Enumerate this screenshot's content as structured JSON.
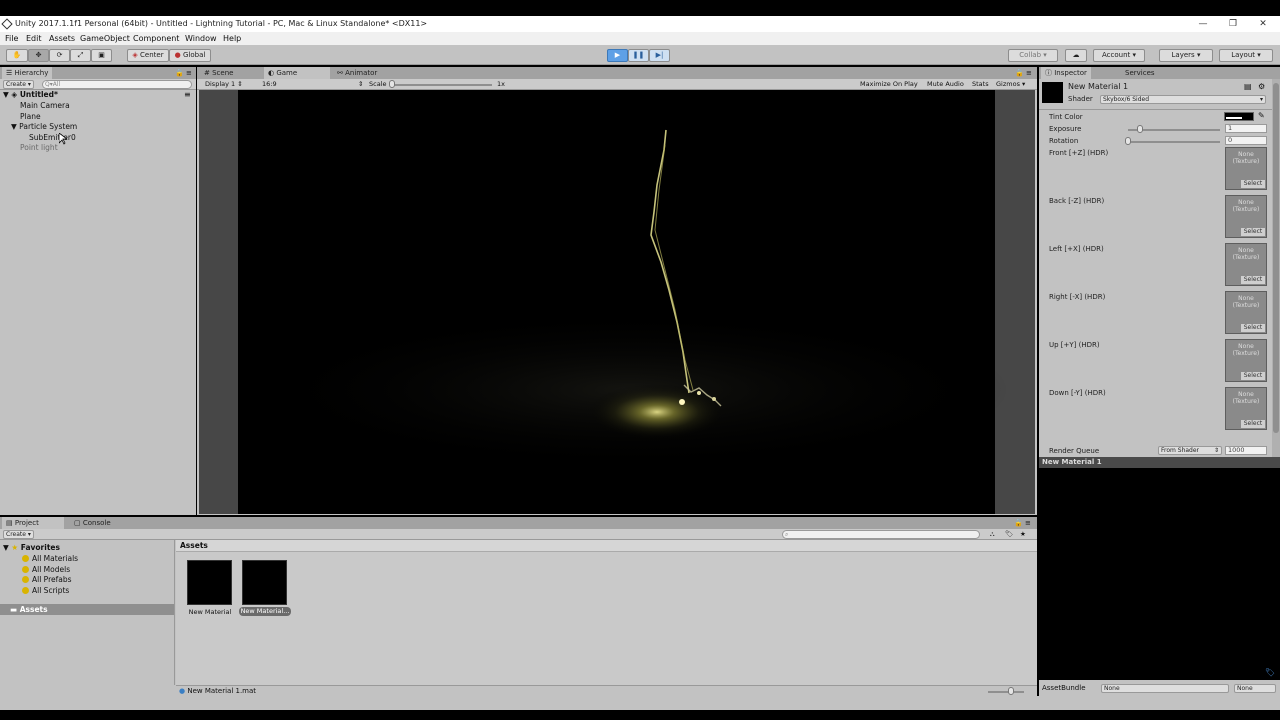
{
  "window": {
    "title": "Unity 2017.1.1f1 Personal (64bit) - Untitled - Lightning Tutorial - PC, Mac & Linux Standalone* <DX11>",
    "minimize_glyph": "—",
    "maximize_glyph": "❐",
    "close_glyph": "✕"
  },
  "menu": {
    "items": [
      "File",
      "Edit",
      "Assets",
      "GameObject",
      "Component",
      "Window",
      "Help"
    ]
  },
  "toolbar": {
    "pivot_label": "Center",
    "space_label": "Global",
    "collab_label": "Collab ▾",
    "account_label": "Account",
    "layers_label": "Layers",
    "layout_label": "Layout"
  },
  "hierarchy": {
    "tab": "Hierarchy",
    "create_label": "Create",
    "search_placeholder": "Q▾All",
    "scene": "Untitled*",
    "items": [
      {
        "label": "Main Camera",
        "indent": 1
      },
      {
        "label": "Plane",
        "indent": 1
      },
      {
        "label": "Particle System",
        "indent": 1,
        "expanded": true
      },
      {
        "label": "SubEmitter0",
        "indent": 2
      },
      {
        "label": "Point light",
        "indent": 1,
        "dim": true
      }
    ]
  },
  "center_tabs": {
    "scene": "Scene",
    "game": "Game",
    "animator": "Animator"
  },
  "game_view": {
    "display": "Display 1",
    "aspect": "16:9",
    "scale_label": "Scale",
    "scale_value": "1x",
    "scale_fraction": 0.0,
    "maximize": "Maximize On Play",
    "mute": "Mute Audio",
    "stats": "Stats",
    "gizmos": "Gizmos"
  },
  "inspector": {
    "tab": "Inspector",
    "services_tab": "Services",
    "material_name": "New Material 1",
    "shader_label": "Shader",
    "shader_value": "Skybox/6 Sided",
    "tint_label": "Tint Color",
    "exposure_label": "Exposure",
    "exposure_value": "1",
    "exposure_fraction": 0.125,
    "rotation_label": "Rotation",
    "rotation_value": "0",
    "rotation_fraction": 0.0,
    "textures": [
      {
        "label": "Front [+Z]   (HDR)"
      },
      {
        "label": "Back [-Z]   (HDR)"
      },
      {
        "label": "Left [+X]   (HDR)"
      },
      {
        "label": "Right [-X]   (HDR)"
      },
      {
        "label": "Up [+Y]   (HDR)"
      },
      {
        "label": "Down [-Y]   (HDR)"
      }
    ],
    "texture_none": "None",
    "texture_type": "(Texture)",
    "select_label": "Select",
    "render_queue_label": "Render Queue",
    "render_queue_mode": "From Shader",
    "render_queue_value": "1000",
    "preview_title": "New Material 1",
    "assetbundle_label": "AssetBundle",
    "assetbundle_value": "None",
    "assetbundle_variant": "None"
  },
  "project": {
    "tab": "Project",
    "console_tab": "Console",
    "create_label": "Create",
    "favorites_label": "Favorites",
    "favorites": [
      "All Materials",
      "All Models",
      "All Prefabs",
      "All Scripts"
    ],
    "assets_root": "Assets",
    "assets_header": "Assets",
    "assets": [
      {
        "label": "New Material"
      },
      {
        "label": "New Material..."
      }
    ],
    "footer_file": "New Material 1.mat"
  }
}
